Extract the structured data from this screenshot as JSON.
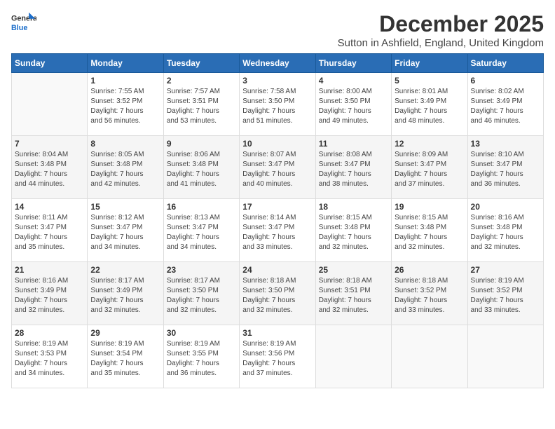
{
  "header": {
    "logo_line1": "General",
    "logo_line2": "Blue",
    "month_year": "December 2025",
    "location": "Sutton in Ashfield, England, United Kingdom"
  },
  "days_of_week": [
    "Sunday",
    "Monday",
    "Tuesday",
    "Wednesday",
    "Thursday",
    "Friday",
    "Saturday"
  ],
  "weeks": [
    [
      {
        "day": "",
        "info": ""
      },
      {
        "day": "1",
        "info": "Sunrise: 7:55 AM\nSunset: 3:52 PM\nDaylight: 7 hours\nand 56 minutes."
      },
      {
        "day": "2",
        "info": "Sunrise: 7:57 AM\nSunset: 3:51 PM\nDaylight: 7 hours\nand 53 minutes."
      },
      {
        "day": "3",
        "info": "Sunrise: 7:58 AM\nSunset: 3:50 PM\nDaylight: 7 hours\nand 51 minutes."
      },
      {
        "day": "4",
        "info": "Sunrise: 8:00 AM\nSunset: 3:50 PM\nDaylight: 7 hours\nand 49 minutes."
      },
      {
        "day": "5",
        "info": "Sunrise: 8:01 AM\nSunset: 3:49 PM\nDaylight: 7 hours\nand 48 minutes."
      },
      {
        "day": "6",
        "info": "Sunrise: 8:02 AM\nSunset: 3:49 PM\nDaylight: 7 hours\nand 46 minutes."
      }
    ],
    [
      {
        "day": "7",
        "info": "Sunrise: 8:04 AM\nSunset: 3:48 PM\nDaylight: 7 hours\nand 44 minutes."
      },
      {
        "day": "8",
        "info": "Sunrise: 8:05 AM\nSunset: 3:48 PM\nDaylight: 7 hours\nand 42 minutes."
      },
      {
        "day": "9",
        "info": "Sunrise: 8:06 AM\nSunset: 3:48 PM\nDaylight: 7 hours\nand 41 minutes."
      },
      {
        "day": "10",
        "info": "Sunrise: 8:07 AM\nSunset: 3:47 PM\nDaylight: 7 hours\nand 40 minutes."
      },
      {
        "day": "11",
        "info": "Sunrise: 8:08 AM\nSunset: 3:47 PM\nDaylight: 7 hours\nand 38 minutes."
      },
      {
        "day": "12",
        "info": "Sunrise: 8:09 AM\nSunset: 3:47 PM\nDaylight: 7 hours\nand 37 minutes."
      },
      {
        "day": "13",
        "info": "Sunrise: 8:10 AM\nSunset: 3:47 PM\nDaylight: 7 hours\nand 36 minutes."
      }
    ],
    [
      {
        "day": "14",
        "info": "Sunrise: 8:11 AM\nSunset: 3:47 PM\nDaylight: 7 hours\nand 35 minutes."
      },
      {
        "day": "15",
        "info": "Sunrise: 8:12 AM\nSunset: 3:47 PM\nDaylight: 7 hours\nand 34 minutes."
      },
      {
        "day": "16",
        "info": "Sunrise: 8:13 AM\nSunset: 3:47 PM\nDaylight: 7 hours\nand 34 minutes."
      },
      {
        "day": "17",
        "info": "Sunrise: 8:14 AM\nSunset: 3:47 PM\nDaylight: 7 hours\nand 33 minutes."
      },
      {
        "day": "18",
        "info": "Sunrise: 8:15 AM\nSunset: 3:48 PM\nDaylight: 7 hours\nand 32 minutes."
      },
      {
        "day": "19",
        "info": "Sunrise: 8:15 AM\nSunset: 3:48 PM\nDaylight: 7 hours\nand 32 minutes."
      },
      {
        "day": "20",
        "info": "Sunrise: 8:16 AM\nSunset: 3:48 PM\nDaylight: 7 hours\nand 32 minutes."
      }
    ],
    [
      {
        "day": "21",
        "info": "Sunrise: 8:16 AM\nSunset: 3:49 PM\nDaylight: 7 hours\nand 32 minutes."
      },
      {
        "day": "22",
        "info": "Sunrise: 8:17 AM\nSunset: 3:49 PM\nDaylight: 7 hours\nand 32 minutes."
      },
      {
        "day": "23",
        "info": "Sunrise: 8:17 AM\nSunset: 3:50 PM\nDaylight: 7 hours\nand 32 minutes."
      },
      {
        "day": "24",
        "info": "Sunrise: 8:18 AM\nSunset: 3:50 PM\nDaylight: 7 hours\nand 32 minutes."
      },
      {
        "day": "25",
        "info": "Sunrise: 8:18 AM\nSunset: 3:51 PM\nDaylight: 7 hours\nand 32 minutes."
      },
      {
        "day": "26",
        "info": "Sunrise: 8:18 AM\nSunset: 3:52 PM\nDaylight: 7 hours\nand 33 minutes."
      },
      {
        "day": "27",
        "info": "Sunrise: 8:19 AM\nSunset: 3:52 PM\nDaylight: 7 hours\nand 33 minutes."
      }
    ],
    [
      {
        "day": "28",
        "info": "Sunrise: 8:19 AM\nSunset: 3:53 PM\nDaylight: 7 hours\nand 34 minutes."
      },
      {
        "day": "29",
        "info": "Sunrise: 8:19 AM\nSunset: 3:54 PM\nDaylight: 7 hours\nand 35 minutes."
      },
      {
        "day": "30",
        "info": "Sunrise: 8:19 AM\nSunset: 3:55 PM\nDaylight: 7 hours\nand 36 minutes."
      },
      {
        "day": "31",
        "info": "Sunrise: 8:19 AM\nSunset: 3:56 PM\nDaylight: 7 hours\nand 37 minutes."
      },
      {
        "day": "",
        "info": ""
      },
      {
        "day": "",
        "info": ""
      },
      {
        "day": "",
        "info": ""
      }
    ]
  ]
}
